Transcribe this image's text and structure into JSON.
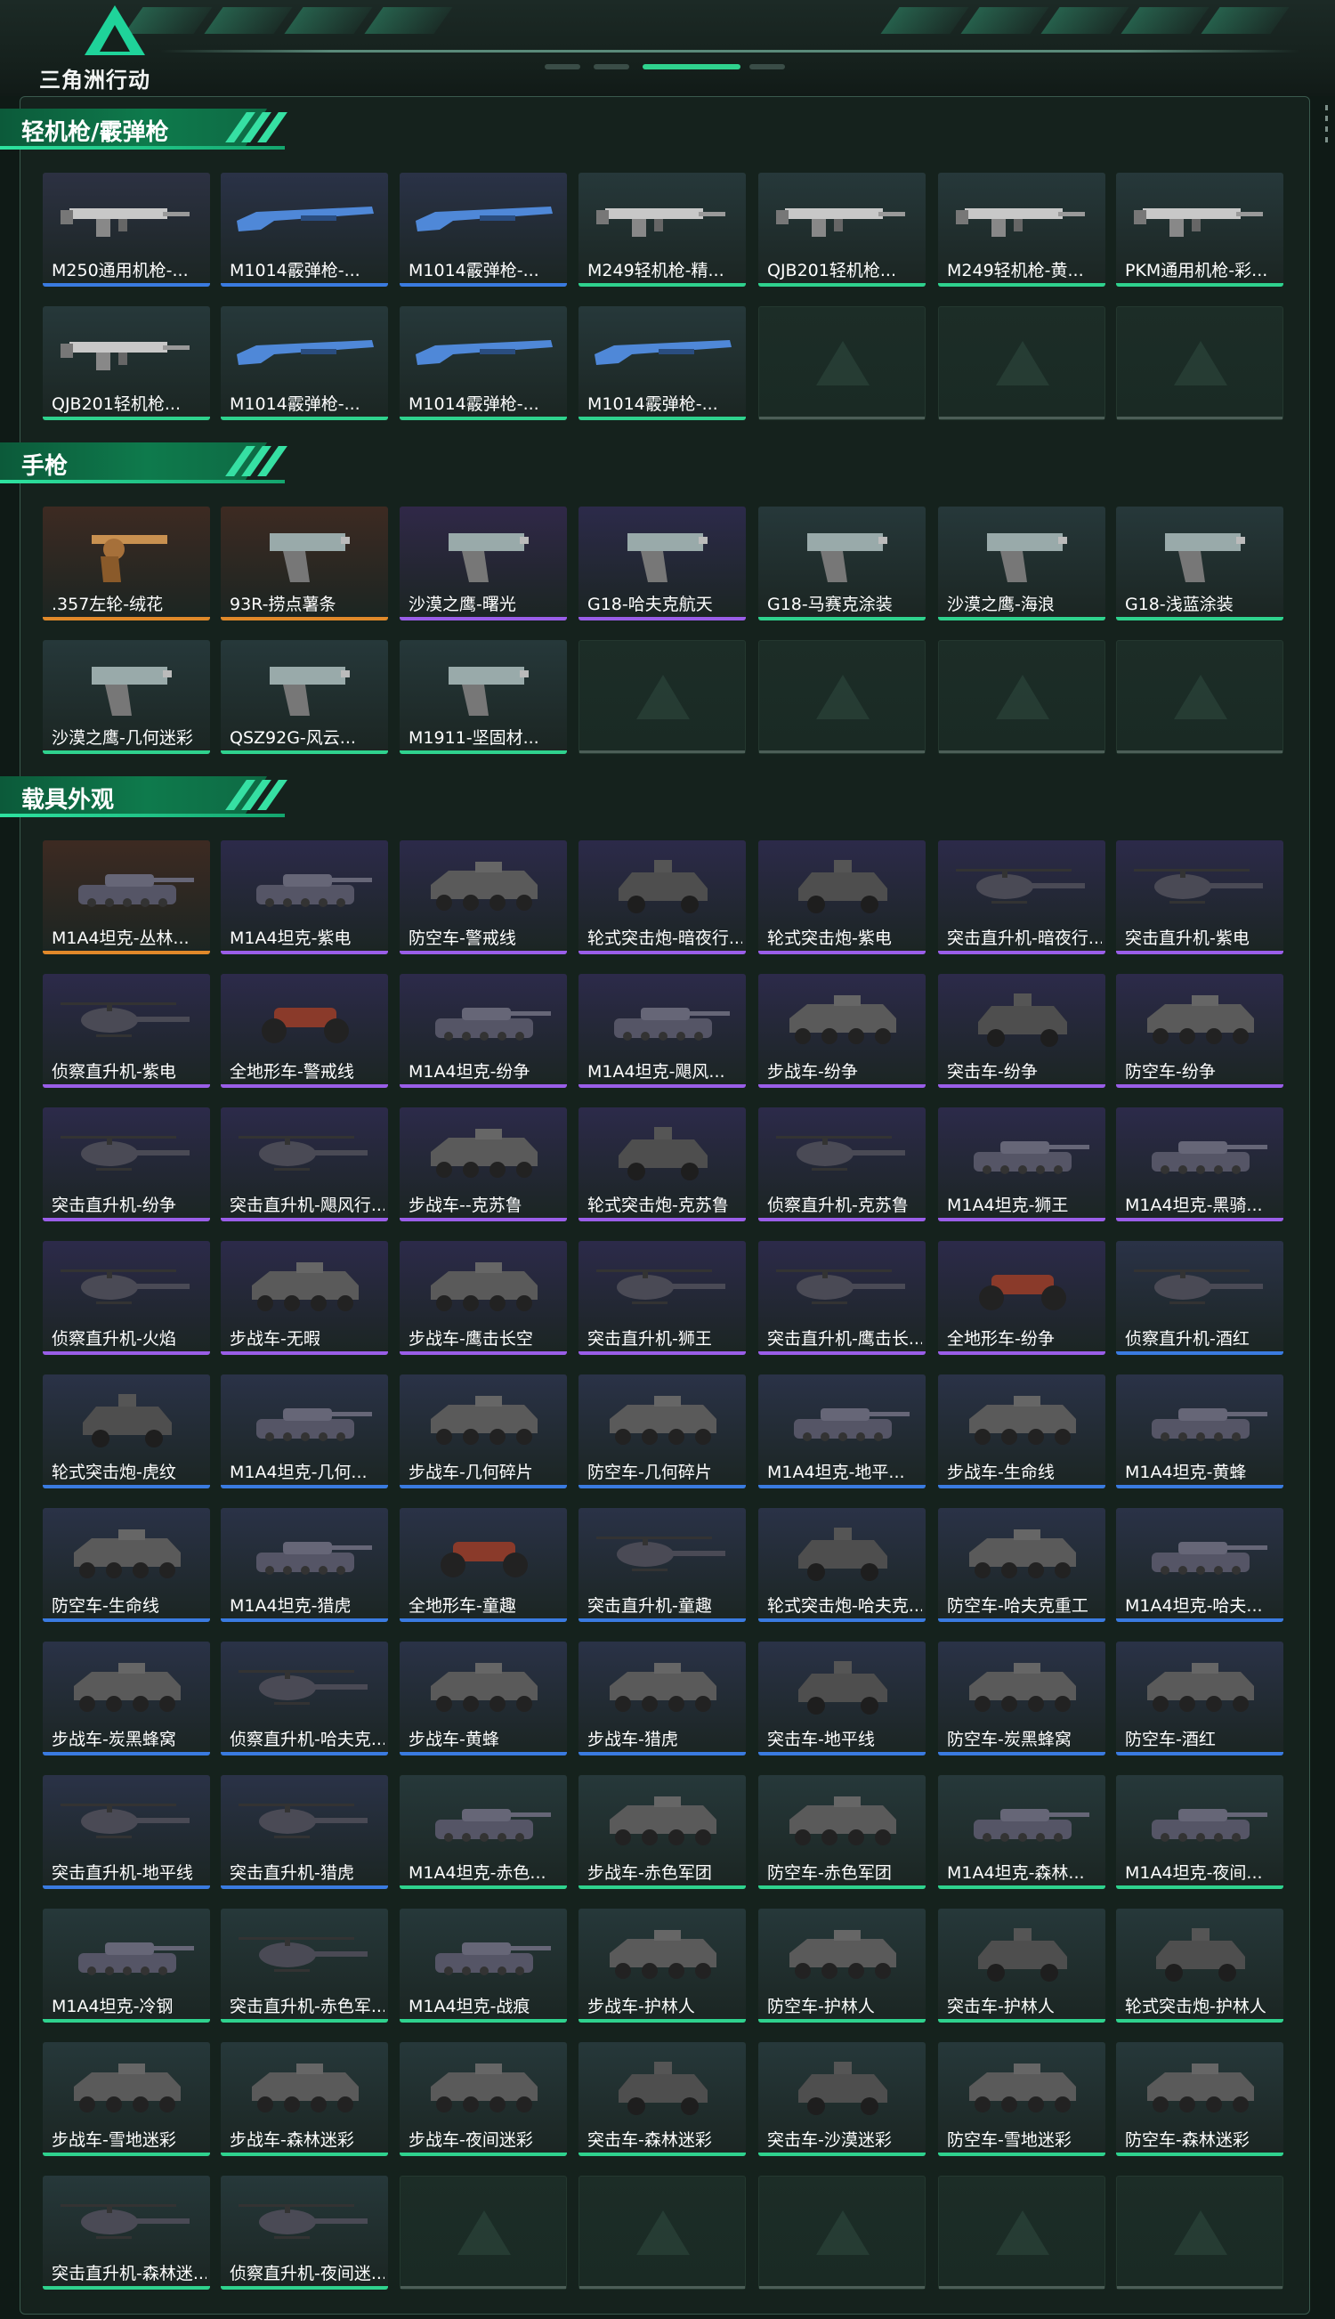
{
  "header": {
    "logo_text": "三角洲行动",
    "logo_name": "delta-force-logo"
  },
  "colors": {
    "orange": "#e0892a",
    "blue": "#3a7be0",
    "purple": "#9a5ee8",
    "green": "#2fd28e",
    "accent": "#1fd39a"
  },
  "sections": [
    {
      "title": "轻机枪/霰弹枪",
      "items": [
        {
          "label": "M250通用机枪-...",
          "rarity": "blue",
          "icon": "lmg-icon",
          "art": "#2c3142"
        },
        {
          "label": "M1014霰弹枪-...",
          "rarity": "blue",
          "icon": "shotgun-icon",
          "art": "#2a3247"
        },
        {
          "label": "M1014霰弹枪-...",
          "rarity": "blue",
          "icon": "shotgun-icon",
          "art": "#2a3247"
        },
        {
          "label": "M249轻机枪-精...",
          "rarity": "green",
          "icon": "lmg-icon",
          "art": "#26383a"
        },
        {
          "label": "QJB201轻机枪...",
          "rarity": "green",
          "icon": "lmg-icon",
          "art": "#26383a"
        },
        {
          "label": "M249轻机枪-黄...",
          "rarity": "green",
          "icon": "lmg-icon",
          "art": "#26383a"
        },
        {
          "label": "PKM通用机枪-彩...",
          "rarity": "green",
          "icon": "lmg-icon",
          "art": "#26383a"
        },
        {
          "label": "QJB201轻机枪...",
          "rarity": "green",
          "icon": "lmg-icon",
          "art": "#26383a"
        },
        {
          "label": "M1014霰弹枪-...",
          "rarity": "green",
          "icon": "shotgun-icon",
          "art": "#26383a"
        },
        {
          "label": "M1014霰弹枪-...",
          "rarity": "green",
          "icon": "shotgun-icon",
          "art": "#26383a"
        },
        {
          "label": "M1014霰弹枪-...",
          "rarity": "green",
          "icon": "shotgun-icon",
          "art": "#26383a"
        }
      ]
    },
    {
      "title": "手枪",
      "items": [
        {
          "label": ".357左轮-绒花",
          "rarity": "orange",
          "icon": "revolver-icon",
          "art": "#3d2a22"
        },
        {
          "label": "93R-捞点薯条",
          "rarity": "orange",
          "icon": "pistol-icon",
          "art": "#3d2a22"
        },
        {
          "label": "沙漠之鹰-曙光",
          "rarity": "purple",
          "icon": "pistol-icon",
          "art": "#302848"
        },
        {
          "label": "G18-哈夫克航天",
          "rarity": "purple",
          "icon": "pistol-icon",
          "art": "#2c2a4a"
        },
        {
          "label": "G18-马赛克涂装",
          "rarity": "green",
          "icon": "pistol-icon",
          "art": "#26383a"
        },
        {
          "label": "沙漠之鹰-海浪",
          "rarity": "green",
          "icon": "pistol-icon",
          "art": "#26383a"
        },
        {
          "label": "G18-浅蓝涂装",
          "rarity": "green",
          "icon": "pistol-icon",
          "art": "#26383a"
        },
        {
          "label": "沙漠之鹰-几何迷彩",
          "rarity": "green",
          "icon": "pistol-icon",
          "art": "#26383a"
        },
        {
          "label": "QSZ92G-风云...",
          "rarity": "green",
          "icon": "pistol-icon",
          "art": "#26383a"
        },
        {
          "label": "M1911-坚固材...",
          "rarity": "green",
          "icon": "pistol-icon",
          "art": "#26383a"
        }
      ]
    },
    {
      "title": "载具外观",
      "items": [
        {
          "label": "M1A4坦克-丛林...",
          "rarity": "orange",
          "icon": "tank-icon",
          "art": "#3d2a22"
        },
        {
          "label": "M1A4坦克-紫电",
          "rarity": "purple",
          "icon": "tank-icon",
          "art": "#2c2a4a"
        },
        {
          "label": "防空车-警戒线",
          "rarity": "purple",
          "icon": "apc-icon",
          "art": "#2c2a4a"
        },
        {
          "label": "轮式突击炮-暗夜行...",
          "rarity": "purple",
          "icon": "armored-car-icon",
          "art": "#2c2a4a"
        },
        {
          "label": "轮式突击炮-紫电",
          "rarity": "purple",
          "icon": "armored-car-icon",
          "art": "#2c2a4a"
        },
        {
          "label": "突击直升机-暗夜行...",
          "rarity": "purple",
          "icon": "helicopter-icon",
          "art": "#2c2a4a"
        },
        {
          "label": "突击直升机-紫电",
          "rarity": "purple",
          "icon": "helicopter-icon",
          "art": "#2c2a4a"
        },
        {
          "label": "侦察直升机-紫电",
          "rarity": "purple",
          "icon": "helicopter-icon",
          "art": "#2c2a4a"
        },
        {
          "label": "全地形车-警戒线",
          "rarity": "purple",
          "icon": "atv-icon",
          "art": "#2c2a4a"
        },
        {
          "label": "M1A4坦克-纷争",
          "rarity": "purple",
          "icon": "tank-icon",
          "art": "#2c2a4a"
        },
        {
          "label": "M1A4坦克-飓风...",
          "rarity": "purple",
          "icon": "tank-icon",
          "art": "#2c2a4a"
        },
        {
          "label": "步战车-纷争",
          "rarity": "purple",
          "icon": "apc-icon",
          "art": "#2c2a4a"
        },
        {
          "label": "突击车-纷争",
          "rarity": "purple",
          "icon": "armored-car-icon",
          "art": "#2c2a4a"
        },
        {
          "label": "防空车-纷争",
          "rarity": "purple",
          "icon": "apc-icon",
          "art": "#2c2a4a"
        },
        {
          "label": "突击直升机-纷争",
          "rarity": "purple",
          "icon": "helicopter-icon",
          "art": "#2c2a4a"
        },
        {
          "label": "突击直升机-飓风行...",
          "rarity": "purple",
          "icon": "helicopter-icon",
          "art": "#2c2a4a"
        },
        {
          "label": "步战车--克苏鲁",
          "rarity": "purple",
          "icon": "apc-icon",
          "art": "#2c2a4a"
        },
        {
          "label": "轮式突击炮-克苏鲁",
          "rarity": "purple",
          "icon": "armored-car-icon",
          "art": "#2c2a4a"
        },
        {
          "label": "侦察直升机-克苏鲁",
          "rarity": "purple",
          "icon": "helicopter-icon",
          "art": "#2c2a4a"
        },
        {
          "label": "M1A4坦克-狮王",
          "rarity": "purple",
          "icon": "tank-icon",
          "art": "#2c2a4a"
        },
        {
          "label": "M1A4坦克-黑骑...",
          "rarity": "purple",
          "icon": "tank-icon",
          "art": "#2c2a4a"
        },
        {
          "label": "侦察直升机-火焰",
          "rarity": "purple",
          "icon": "helicopter-icon",
          "art": "#2c2a4a"
        },
        {
          "label": "步战车-无暇",
          "rarity": "purple",
          "icon": "apc-icon",
          "art": "#2c2a4a"
        },
        {
          "label": "步战车-鹰击长空",
          "rarity": "purple",
          "icon": "apc-icon",
          "art": "#2c2a4a"
        },
        {
          "label": "突击直升机-狮王",
          "rarity": "purple",
          "icon": "helicopter-icon",
          "art": "#2c2a4a"
        },
        {
          "label": "突击直升机-鹰击长...",
          "rarity": "purple",
          "icon": "helicopter-icon",
          "art": "#2c2a4a"
        },
        {
          "label": "全地形车-纷争",
          "rarity": "purple",
          "icon": "atv-icon",
          "art": "#2c2a4a"
        },
        {
          "label": "侦察直升机-酒红",
          "rarity": "blue",
          "icon": "helicopter-icon",
          "art": "#2a3247"
        },
        {
          "label": "轮式突击炮-虎纹",
          "rarity": "blue",
          "icon": "armored-car-icon",
          "art": "#2a3247"
        },
        {
          "label": "M1A4坦克-几何...",
          "rarity": "blue",
          "icon": "tank-icon",
          "art": "#2a3247"
        },
        {
          "label": "步战车-几何碎片",
          "rarity": "blue",
          "icon": "apc-icon",
          "art": "#2a3247"
        },
        {
          "label": "防空车-几何碎片",
          "rarity": "blue",
          "icon": "apc-icon",
          "art": "#2a3247"
        },
        {
          "label": "M1A4坦克-地平...",
          "rarity": "blue",
          "icon": "tank-icon",
          "art": "#2a3247"
        },
        {
          "label": "步战车-生命线",
          "rarity": "blue",
          "icon": "apc-icon",
          "art": "#2a3247"
        },
        {
          "label": "M1A4坦克-黄蜂",
          "rarity": "blue",
          "icon": "tank-icon",
          "art": "#2a3247"
        },
        {
          "label": "防空车-生命线",
          "rarity": "blue",
          "icon": "apc-icon",
          "art": "#2a3247"
        },
        {
          "label": "M1A4坦克-猎虎",
          "rarity": "blue",
          "icon": "tank-icon",
          "art": "#2a3247"
        },
        {
          "label": "全地形车-童趣",
          "rarity": "blue",
          "icon": "atv-icon",
          "art": "#2a3247"
        },
        {
          "label": "突击直升机-童趣",
          "rarity": "blue",
          "icon": "helicopter-icon",
          "art": "#2a3247"
        },
        {
          "label": "轮式突击炮-哈夫克...",
          "rarity": "blue",
          "icon": "armored-car-icon",
          "art": "#2a3247"
        },
        {
          "label": "防空车-哈夫克重工",
          "rarity": "blue",
          "icon": "apc-icon",
          "art": "#2a3247"
        },
        {
          "label": "M1A4坦克-哈夫...",
          "rarity": "blue",
          "icon": "tank-icon",
          "art": "#2a3247"
        },
        {
          "label": "步战车-炭黑蜂窝",
          "rarity": "blue",
          "icon": "apc-icon",
          "art": "#2a3247"
        },
        {
          "label": "侦察直升机-哈夫克...",
          "rarity": "blue",
          "icon": "helicopter-icon",
          "art": "#2a3247"
        },
        {
          "label": "步战车-黄蜂",
          "rarity": "blue",
          "icon": "apc-icon",
          "art": "#2a3247"
        },
        {
          "label": "步战车-猎虎",
          "rarity": "blue",
          "icon": "apc-icon",
          "art": "#2a3247"
        },
        {
          "label": "突击车-地平线",
          "rarity": "blue",
          "icon": "armored-car-icon",
          "art": "#2a3247"
        },
        {
          "label": "防空车-炭黑蜂窝",
          "rarity": "blue",
          "icon": "apc-icon",
          "art": "#2a3247"
        },
        {
          "label": "防空车-酒红",
          "rarity": "blue",
          "icon": "apc-icon",
          "art": "#2a3247"
        },
        {
          "label": "突击直升机-地平线",
          "rarity": "blue",
          "icon": "helicopter-icon",
          "art": "#2a3247"
        },
        {
          "label": "突击直升机-猎虎",
          "rarity": "blue",
          "icon": "helicopter-icon",
          "art": "#2a3247"
        },
        {
          "label": "M1A4坦克-赤色...",
          "rarity": "green",
          "icon": "tank-icon",
          "art": "#26383a"
        },
        {
          "label": "步战车-赤色军团",
          "rarity": "green",
          "icon": "apc-icon",
          "art": "#26383a"
        },
        {
          "label": "防空车-赤色军团",
          "rarity": "green",
          "icon": "apc-icon",
          "art": "#26383a"
        },
        {
          "label": "M1A4坦克-森林...",
          "rarity": "green",
          "icon": "tank-icon",
          "art": "#26383a"
        },
        {
          "label": "M1A4坦克-夜间...",
          "rarity": "green",
          "icon": "tank-icon",
          "art": "#26383a"
        },
        {
          "label": "M1A4坦克-冷钢",
          "rarity": "green",
          "icon": "tank-icon",
          "art": "#26383a"
        },
        {
          "label": "突击直升机-赤色军...",
          "rarity": "green",
          "icon": "helicopter-icon",
          "art": "#26383a"
        },
        {
          "label": "M1A4坦克-战痕",
          "rarity": "green",
          "icon": "tank-icon",
          "art": "#26383a"
        },
        {
          "label": "步战车-护林人",
          "rarity": "green",
          "icon": "apc-icon",
          "art": "#26383a"
        },
        {
          "label": "防空车-护林人",
          "rarity": "green",
          "icon": "apc-icon",
          "art": "#26383a"
        },
        {
          "label": "突击车-护林人",
          "rarity": "green",
          "icon": "armored-car-icon",
          "art": "#26383a"
        },
        {
          "label": "轮式突击炮-护林人",
          "rarity": "green",
          "icon": "armored-car-icon",
          "art": "#26383a"
        },
        {
          "label": "步战车-雪地迷彩",
          "rarity": "green",
          "icon": "apc-icon",
          "art": "#26383a"
        },
        {
          "label": "步战车-森林迷彩",
          "rarity": "green",
          "icon": "apc-icon",
          "art": "#26383a"
        },
        {
          "label": "步战车-夜间迷彩",
          "rarity": "green",
          "icon": "apc-icon",
          "art": "#26383a"
        },
        {
          "label": "突击车-森林迷彩",
          "rarity": "green",
          "icon": "armored-car-icon",
          "art": "#26383a"
        },
        {
          "label": "突击车-沙漠迷彩",
          "rarity": "green",
          "icon": "armored-car-icon",
          "art": "#26383a"
        },
        {
          "label": "防空车-雪地迷彩",
          "rarity": "green",
          "icon": "apc-icon",
          "art": "#26383a"
        },
        {
          "label": "防空车-森林迷彩",
          "rarity": "green",
          "icon": "apc-icon",
          "art": "#26383a"
        },
        {
          "label": "突击直升机-森林迷...",
          "rarity": "green",
          "icon": "helicopter-icon",
          "art": "#26383a"
        },
        {
          "label": "侦察直升机-夜间迷...",
          "rarity": "green",
          "icon": "helicopter-icon",
          "art": "#26383a"
        }
      ]
    }
  ]
}
